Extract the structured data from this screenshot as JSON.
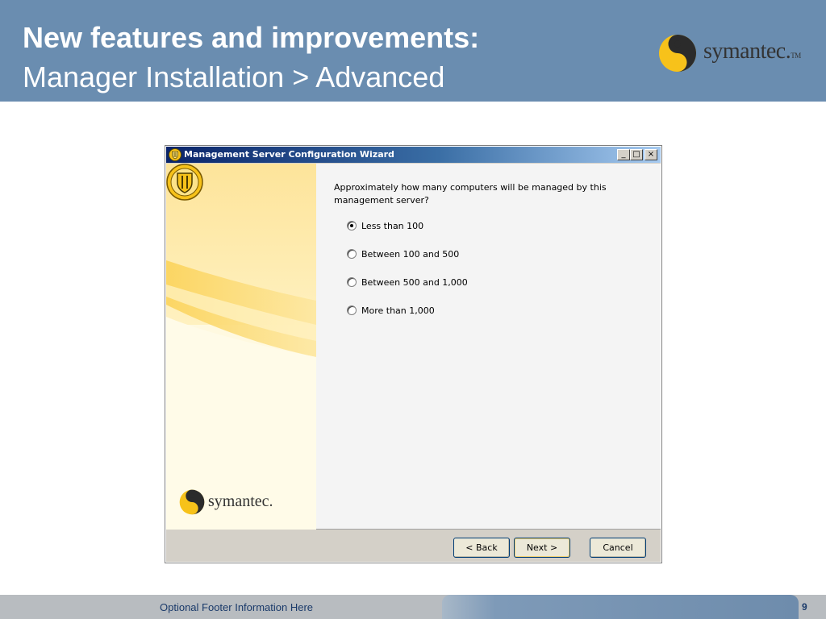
{
  "slide": {
    "title": "New features and improvements:",
    "subtitle": "Manager Installation > Advanced",
    "logo_text": "symantec.",
    "logo_tm": "TM"
  },
  "wizard": {
    "title": "Management Server Configuration Wizard",
    "window_buttons": {
      "minimize": "_",
      "maximize": "□",
      "close": "×"
    },
    "side_logo_text": "symantec.",
    "question": "Approximately how many computers will be managed by this management server?",
    "options": [
      {
        "label": "Less than 100",
        "checked": true
      },
      {
        "label": "Between 100 and 500",
        "checked": false
      },
      {
        "label": "Between 500 and 1,000",
        "checked": false
      },
      {
        "label": "More than 1,000",
        "checked": false
      }
    ],
    "buttons": {
      "back": "< Back",
      "next": "Next >",
      "cancel": "Cancel"
    }
  },
  "footer": {
    "text": "Optional Footer Information Here",
    "page_number": "9"
  },
  "colors": {
    "header_bg": "#6a8db0",
    "titlebar_start": "#0a246a",
    "titlebar_end": "#a6caf0",
    "accent_yellow": "#f7c21a"
  }
}
